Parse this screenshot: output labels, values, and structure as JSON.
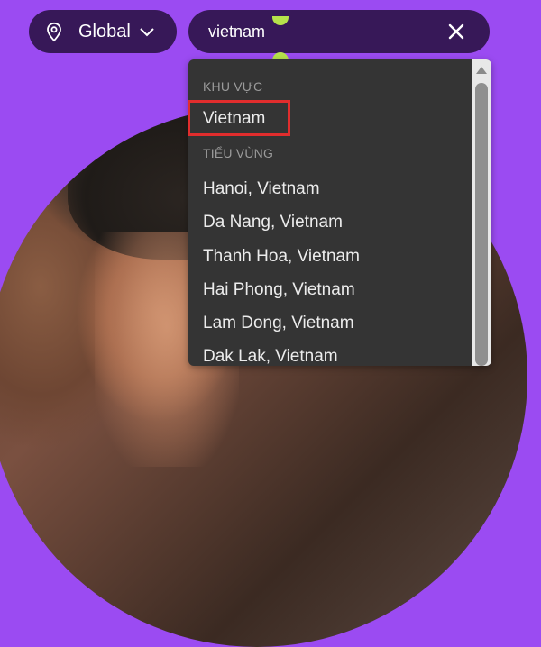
{
  "header": {
    "region_label": "Global",
    "search_value": "vietnam"
  },
  "dropdown": {
    "section_region": "KHU VỰC",
    "region_items": [
      "Vietnam"
    ],
    "section_subregion": "TIỂU VÙNG",
    "subregion_items": [
      "Hanoi, Vietnam",
      "Da Nang, Vietnam",
      "Thanh Hoa, Vietnam",
      "Hai Phong, Vietnam",
      "Lam Dong, Vietnam",
      "Dak Lak, Vietnam"
    ]
  },
  "icons": {
    "region": "location-pin-icon",
    "dropdown": "chevron-down-icon",
    "clear": "close-icon"
  },
  "colors": {
    "background": "#9b4bf2",
    "pill": "#371858",
    "dropdown": "#343434",
    "highlight": "#e12d2d",
    "cursor_handles": "#b6e24b"
  }
}
